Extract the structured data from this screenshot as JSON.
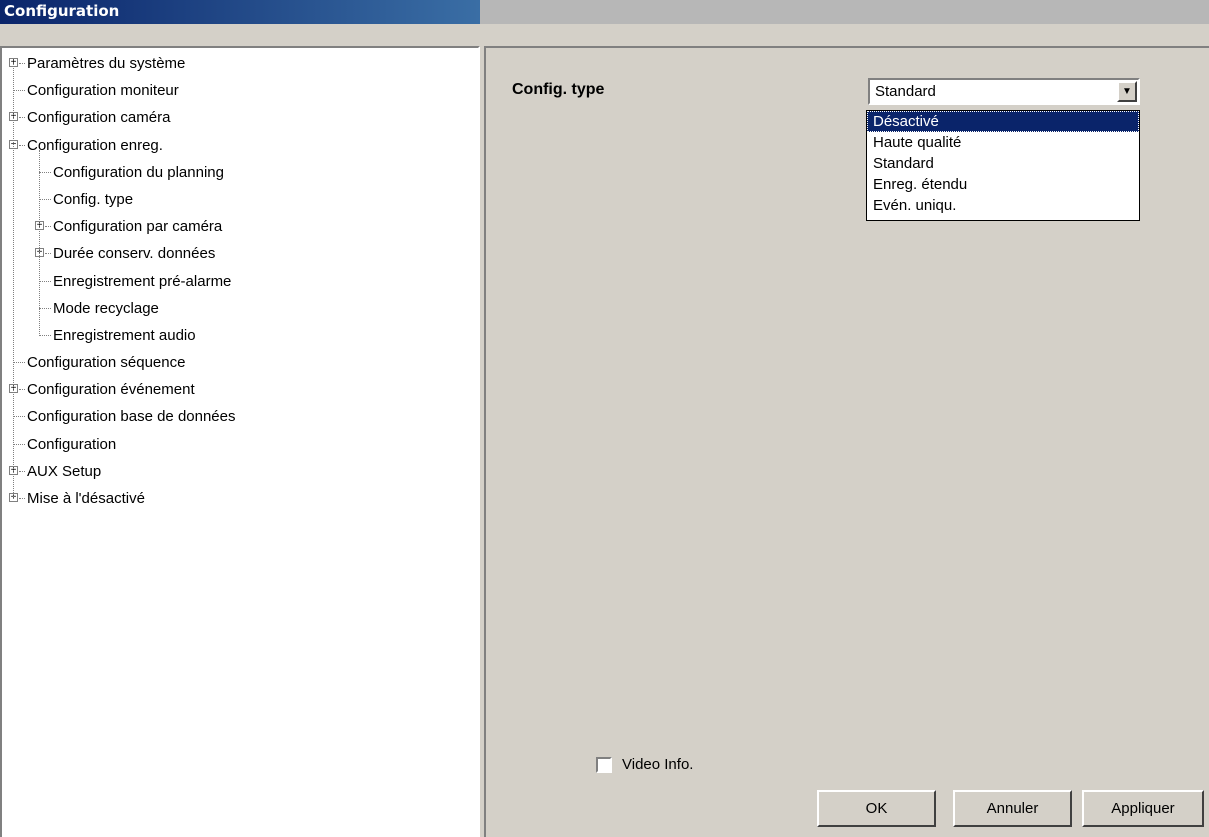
{
  "window": {
    "title": "Configuration"
  },
  "tree": {
    "items": [
      {
        "label": "Paramètres du système",
        "level": 0,
        "expander": "+"
      },
      {
        "label": "Configuration moniteur",
        "level": 0,
        "expander": ""
      },
      {
        "label": "Configuration caméra",
        "level": 0,
        "expander": "+"
      },
      {
        "label": "Configuration enreg.",
        "level": 0,
        "expander": "−"
      },
      {
        "label": "Configuration du planning",
        "level": 1,
        "expander": ""
      },
      {
        "label": "Config. type",
        "level": 1,
        "expander": ""
      },
      {
        "label": "Configuration par caméra",
        "level": 1,
        "expander": "+"
      },
      {
        "label": "Durée conserv. données",
        "level": 1,
        "expander": "+"
      },
      {
        "label": "Enregistrement pré-alarme",
        "level": 1,
        "expander": ""
      },
      {
        "label": "Mode recyclage",
        "level": 1,
        "expander": ""
      },
      {
        "label": "Enregistrement audio",
        "level": 1,
        "expander": ""
      },
      {
        "label": "Configuration séquence",
        "level": 0,
        "expander": ""
      },
      {
        "label": "Configuration événement",
        "level": 0,
        "expander": "+"
      },
      {
        "label": "Configuration base de données",
        "level": 0,
        "expander": ""
      },
      {
        "label": "Configuration",
        "level": 0,
        "expander": ""
      },
      {
        "label": "AUX Setup",
        "level": 0,
        "expander": "+"
      },
      {
        "label": "Mise à l'désactivé",
        "level": 0,
        "expander": "+"
      }
    ]
  },
  "content": {
    "config_type_label": "Config. type",
    "combo_value": "Standard",
    "dropdown_options": [
      "Désactivé",
      "Haute qualité",
      "Standard",
      "Enreg. étendu",
      "Evén. uniqu."
    ],
    "selected_option": "Désactivé",
    "video_info_label": "Video Info.",
    "video_info_checked": false
  },
  "buttons": {
    "ok": "OK",
    "cancel": "Annuler",
    "apply": "Appliquer"
  }
}
